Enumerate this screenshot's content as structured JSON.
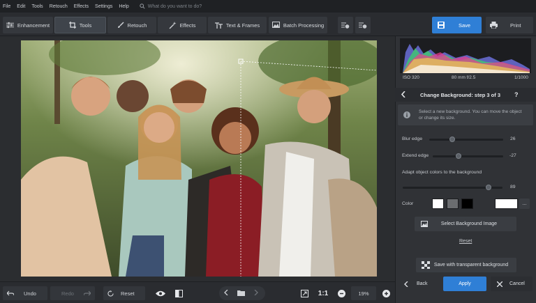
{
  "menu": [
    "File",
    "Edit",
    "Tools",
    "Retouch",
    "Effects",
    "Settings",
    "Help"
  ],
  "search_placeholder": "What do you want to do?",
  "tabs": [
    {
      "label": "Enhancement",
      "icon": "sliders-icon"
    },
    {
      "label": "Tools",
      "icon": "crop-icon",
      "active": true
    },
    {
      "label": "Retouch",
      "icon": "brush-icon"
    },
    {
      "label": "Effects",
      "icon": "magic-wand-icon"
    },
    {
      "label": "Text & Frames",
      "icon": "text-icon"
    },
    {
      "label": "Batch Processing",
      "icon": "batch-icon"
    }
  ],
  "save_label": "Save",
  "print_label": "Print",
  "histogram_info": {
    "iso": "ISO 320",
    "lens": "80 mm f/2.5",
    "shutter": "1/1000"
  },
  "panel": {
    "title": "Change Background: step 3 of 3",
    "help": "?",
    "info": "Select a new background. You can move the object or change its size.",
    "blur_edge_label": "Blur edge",
    "blur_edge_value": "26",
    "extend_edge_label": "Extend edge",
    "extend_edge_value": "-27",
    "adapt_label": "Adapt object colors to the background",
    "adapt_value": "89",
    "color_label": "Color",
    "more_label": "...",
    "select_bg_label": "Select Background Image",
    "reset_label": "Reset",
    "save_transparent_label": "Save with transparent background",
    "back_label": "Back",
    "apply_label": "Apply",
    "cancel_label": "Cancel"
  },
  "bottom": {
    "undo_label": "Undo",
    "redo_label": "Redo",
    "reset_label": "Reset",
    "ratio_label": "1:1",
    "zoom_value": "19%"
  },
  "colors": {
    "accent": "#2f7fd6",
    "swatch_white": "#ffffff",
    "swatch_gray": "#6b6d70",
    "swatch_black": "#000000"
  }
}
